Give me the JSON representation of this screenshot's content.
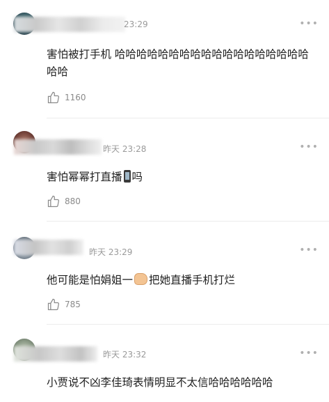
{
  "comments": [
    {
      "time": "23:29",
      "text": "害怕被打手机 哈哈哈哈哈哈哈哈哈哈哈哈哈哈哈哈哈哈哈哈",
      "likes": "1160"
    },
    {
      "time": "昨天 23:28",
      "text_before": "害怕幂幂打直播",
      "text_after": "吗",
      "emoji": "phone-emoji",
      "likes": "880"
    },
    {
      "time": "昨天 23:29",
      "text_before": "他可能是怕娟姐一",
      "text_after": "把她直播手机打烂",
      "emoji": "fist-emoji",
      "likes": "785"
    },
    {
      "time": "昨天 23:32",
      "text": "小贾说不凶李佳琦表情明显不太信哈哈哈哈哈哈"
    }
  ],
  "more_glyph": "•••"
}
